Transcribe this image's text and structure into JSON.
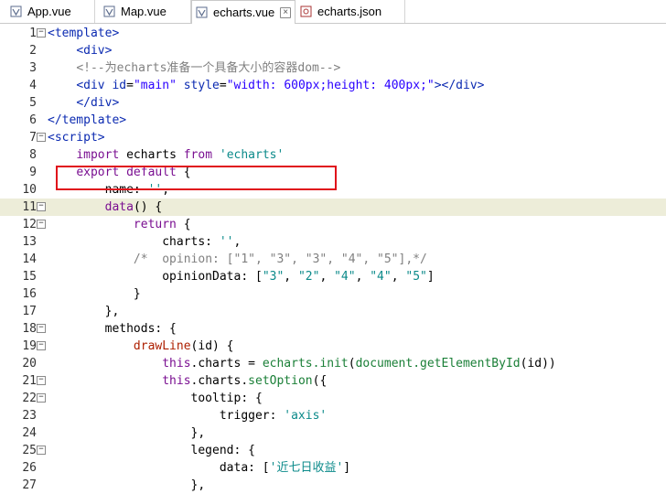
{
  "tabs": [
    {
      "label": "App.vue",
      "icon": "vue-file-icon"
    },
    {
      "label": "Map.vue",
      "icon": "vue-file-icon"
    },
    {
      "label": "echarts.vue",
      "icon": "vue-file-icon",
      "active": true
    },
    {
      "label": "echarts.json",
      "icon": "json-file-icon"
    }
  ],
  "tab_close": "×",
  "highlight_line": 11,
  "boxed_line": 8,
  "colors": {
    "highlight": "#ededd9",
    "box": "#e0101b"
  },
  "lines": [
    {
      "n": "1",
      "fold": "−",
      "code": [
        [
          "tag",
          "<template>"
        ]
      ]
    },
    {
      "n": "2",
      "fold": "",
      "code": [
        [
          "t",
          "    "
        ],
        [
          "tag",
          "<div>"
        ]
      ]
    },
    {
      "n": "3",
      "fold": "",
      "code": [
        [
          "t",
          "    "
        ],
        [
          "cmt",
          "<!--为echarts准备一个具备大小的容器dom-->"
        ]
      ]
    },
    {
      "n": "4",
      "fold": "",
      "code": [
        [
          "t",
          "    "
        ],
        [
          "tag",
          "<div "
        ],
        [
          "attr",
          "id"
        ],
        [
          "t",
          "="
        ],
        [
          "str",
          "\"main\""
        ],
        [
          "t",
          " "
        ],
        [
          "attr",
          "style"
        ],
        [
          "t",
          "="
        ],
        [
          "str",
          "\"width: 600px;height: 400px;\""
        ],
        [
          "tag",
          "></div>"
        ]
      ]
    },
    {
      "n": "5",
      "fold": "",
      "code": [
        [
          "t",
          "    "
        ],
        [
          "tag",
          "</div>"
        ]
      ]
    },
    {
      "n": "6",
      "fold": "",
      "code": [
        [
          "tag",
          "</template>"
        ]
      ]
    },
    {
      "n": "7",
      "fold": "−",
      "code": [
        [
          "tag",
          "<script>"
        ]
      ]
    },
    {
      "n": "8",
      "fold": "",
      "code": [
        [
          "t",
          "    "
        ],
        [
          "kw",
          "import"
        ],
        [
          "t",
          " echarts "
        ],
        [
          "kw",
          "from"
        ],
        [
          "t",
          " "
        ],
        [
          "teal",
          "'echarts'"
        ]
      ]
    },
    {
      "n": "9",
      "fold": "",
      "code": [
        [
          "t",
          "    "
        ],
        [
          "kw",
          "export default"
        ],
        [
          "t",
          " {"
        ]
      ]
    },
    {
      "n": "10",
      "fold": "",
      "code": [
        [
          "t",
          "        name: "
        ],
        [
          "teal",
          "''"
        ],
        [
          "t",
          ","
        ]
      ]
    },
    {
      "n": "11",
      "fold": "−",
      "code": [
        [
          "t",
          "        "
        ],
        [
          "kw",
          "data"
        ],
        [
          "t",
          "() {"
        ]
      ]
    },
    {
      "n": "12",
      "fold": "−",
      "code": [
        [
          "t",
          "            "
        ],
        [
          "kw",
          "return"
        ],
        [
          "t",
          " {"
        ]
      ]
    },
    {
      "n": "13",
      "fold": "",
      "code": [
        [
          "t",
          "                charts: "
        ],
        [
          "teal",
          "''"
        ],
        [
          "t",
          ","
        ]
      ]
    },
    {
      "n": "14",
      "fold": "",
      "code": [
        [
          "t",
          "            "
        ],
        [
          "cmt",
          "/*  opinion: [\"1\", \"3\", \"3\", \"4\", \"5\"],*/"
        ]
      ]
    },
    {
      "n": "15",
      "fold": "",
      "code": [
        [
          "t",
          "                opinionData: ["
        ],
        [
          "teal",
          "\"3\""
        ],
        [
          "t",
          ", "
        ],
        [
          "teal",
          "\"2\""
        ],
        [
          "t",
          ", "
        ],
        [
          "teal",
          "\"4\""
        ],
        [
          "t",
          ", "
        ],
        [
          "teal",
          "\"4\""
        ],
        [
          "t",
          ", "
        ],
        [
          "teal",
          "\"5\""
        ],
        [
          "t",
          "]"
        ]
      ]
    },
    {
      "n": "16",
      "fold": "",
      "code": [
        [
          "t",
          "            }"
        ]
      ]
    },
    {
      "n": "17",
      "fold": "",
      "code": [
        [
          "t",
          "        },"
        ]
      ]
    },
    {
      "n": "18",
      "fold": "−",
      "code": [
        [
          "t",
          "        methods: {"
        ]
      ]
    },
    {
      "n": "19",
      "fold": "−",
      "code": [
        [
          "t",
          "            "
        ],
        [
          "fn",
          "drawLine"
        ],
        [
          "t",
          "(id) {"
        ]
      ]
    },
    {
      "n": "20",
      "fold": "",
      "code": [
        [
          "t",
          "                "
        ],
        [
          "kw",
          "this"
        ],
        [
          "t",
          ".charts = "
        ],
        [
          "grn",
          "echarts.init"
        ],
        [
          "t",
          "("
        ],
        [
          "grn",
          "document.getElementById"
        ],
        [
          "t",
          "(id))"
        ]
      ]
    },
    {
      "n": "21",
      "fold": "−",
      "code": [
        [
          "t",
          "                "
        ],
        [
          "kw",
          "this"
        ],
        [
          "t",
          ".charts."
        ],
        [
          "grn",
          "setOption"
        ],
        [
          "t",
          "({"
        ]
      ]
    },
    {
      "n": "22",
      "fold": "−",
      "code": [
        [
          "t",
          "                    tooltip: {"
        ]
      ]
    },
    {
      "n": "23",
      "fold": "",
      "code": [
        [
          "t",
          "                        trigger: "
        ],
        [
          "teal",
          "'axis'"
        ]
      ]
    },
    {
      "n": "24",
      "fold": "",
      "code": [
        [
          "t",
          "                    },"
        ]
      ]
    },
    {
      "n": "25",
      "fold": "−",
      "code": [
        [
          "t",
          "                    legend: {"
        ]
      ]
    },
    {
      "n": "26",
      "fold": "",
      "code": [
        [
          "t",
          "                        data: ["
        ],
        [
          "teal",
          "'近七日收益'"
        ],
        [
          "t",
          "]"
        ]
      ]
    },
    {
      "n": "27",
      "fold": "",
      "code": [
        [
          "t",
          "                    },"
        ]
      ]
    }
  ]
}
